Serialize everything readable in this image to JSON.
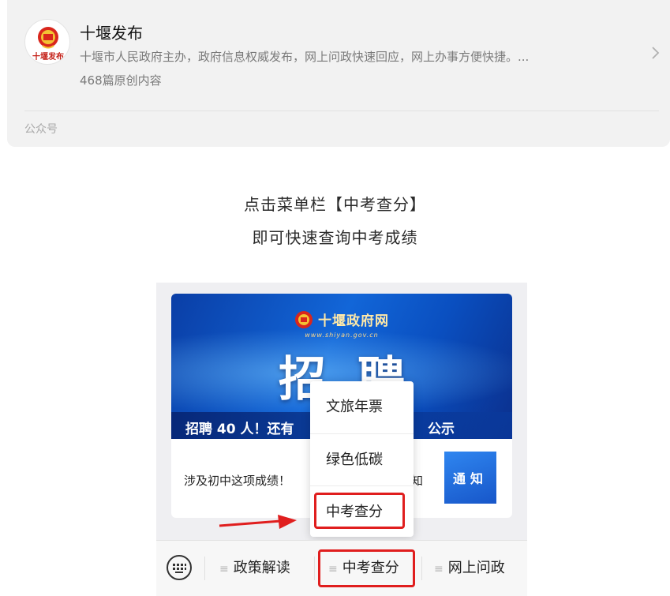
{
  "account": {
    "name": "十堰发布",
    "description": "十堰市人民政府主办，政府信息权威发布，网上问政快速回应，网上办事方便快捷。...",
    "article_count": "468篇原创内容",
    "type_label": "公众号",
    "avatar_text": "十堰发布"
  },
  "caption": {
    "line1": "点击菜单栏【中考查分】",
    "line2": "即可快速查询中考成绩"
  },
  "screenshot": {
    "banner": {
      "site_name": "十堰政府网",
      "site_url": "www.shiyan.gov.cn",
      "big_text": "招聘",
      "strip_text_left": "招聘 40 人！还有",
      "strip_text_right": "公示"
    },
    "news": {
      "title_left": "涉及初中这项成绩！",
      "title_right": "知",
      "thumb_text": "通知"
    },
    "popup_menu": {
      "items": [
        "文旅年票",
        "绿色低碳",
        "中考查分"
      ],
      "highlighted": "中考查分"
    },
    "menubar": {
      "items": [
        "政策解读",
        "中考查分",
        "网上问政"
      ],
      "highlighted": "中考查分",
      "keyboard_icon": "keyboard-icon"
    }
  },
  "colors": {
    "highlight": "#e01e1e",
    "card_bg": "#f2f2f2",
    "banner_blue": "#1266d8"
  }
}
